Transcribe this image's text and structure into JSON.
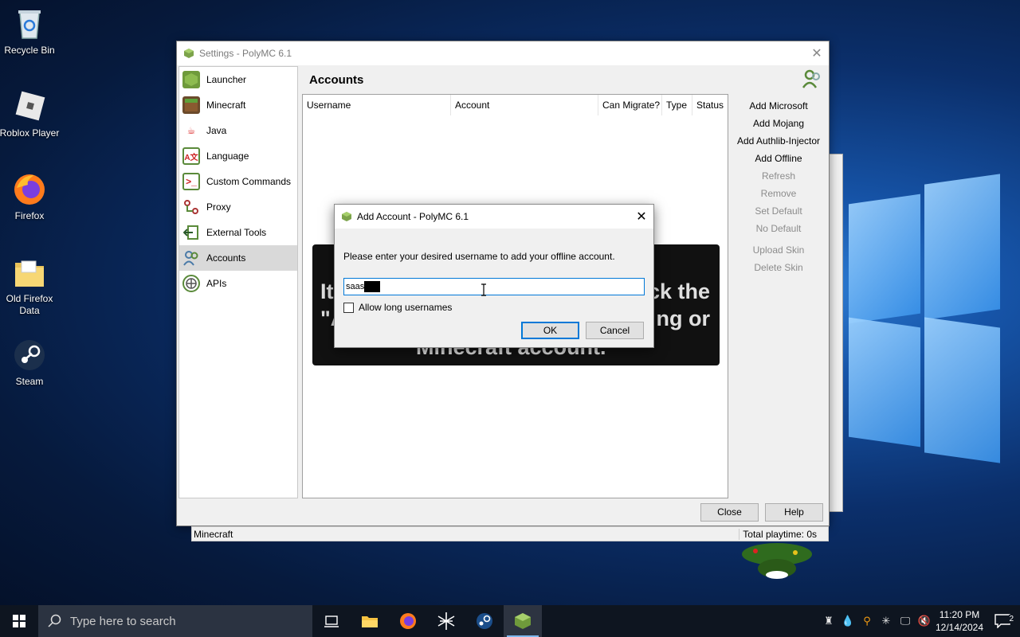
{
  "desktop": {
    "icons": [
      {
        "label": "Recycle Bin",
        "icon": "recycle-bin-icon"
      },
      {
        "label": "Roblox Player",
        "icon": "roblox-icon"
      },
      {
        "label": "Firefox",
        "icon": "firefox-icon"
      },
      {
        "label": "Old Firefox Data",
        "icon": "folder-icon"
      },
      {
        "label": "Steam",
        "icon": "steam-icon"
      }
    ]
  },
  "settings_window": {
    "title": "Settings - PolyMC 6.1",
    "sidebar": [
      {
        "label": "Launcher",
        "icon": "launcher-icon"
      },
      {
        "label": "Minecraft",
        "icon": "minecraft-icon"
      },
      {
        "label": "Java",
        "icon": "java-icon"
      },
      {
        "label": "Language",
        "icon": "language-icon"
      },
      {
        "label": "Custom Commands",
        "icon": "terminal-icon"
      },
      {
        "label": "Proxy",
        "icon": "proxy-icon"
      },
      {
        "label": "External Tools",
        "icon": "external-tools-icon"
      },
      {
        "label": "Accounts",
        "icon": "accounts-icon",
        "active": true
      },
      {
        "label": "APIs",
        "icon": "apis-icon"
      }
    ],
    "page_title": "Accounts",
    "table_headers": [
      "Username",
      "Account",
      "Can Migrate?",
      "Type",
      "Status"
    ],
    "actions": [
      {
        "label": "Add Microsoft",
        "enabled": true
      },
      {
        "label": "Add Mojang",
        "enabled": true
      },
      {
        "label": "Add Authlib-Injector",
        "enabled": true
      },
      {
        "label": "Add Offline",
        "enabled": true
      },
      {
        "label": "Refresh",
        "enabled": false
      },
      {
        "label": "Remove",
        "enabled": false
      },
      {
        "label": "Set Default",
        "enabled": false
      },
      {
        "label": "No Default",
        "enabled": false
      },
      {
        "label": "Upload Skin",
        "enabled": false
      },
      {
        "label": "Delete Skin",
        "enabled": false
      }
    ],
    "close_label": "Close",
    "help_label": "Help"
  },
  "statusbar": {
    "left": "Minecraft",
    "right": "Total playtime: 0s"
  },
  "banner": {
    "line1_left": "It",
    "line1_right": "ck the",
    "line2_left": "\"A",
    "line2_right": "ng or",
    "line3": "Minecraft account."
  },
  "dialog": {
    "title": "Add Account - PolyMC 6.1",
    "message": "Please enter your desired username to add your offline account.",
    "input_value": "saas",
    "checkbox_label": "Allow long usernames",
    "checkbox_checked": false,
    "ok_label": "OK",
    "cancel_label": "Cancel"
  },
  "taskbar": {
    "search_placeholder": "Type here to search",
    "apps": [
      "task-view-icon",
      "file-explorer-icon",
      "firefox-icon",
      "perplexity-icon",
      "steam-icon",
      "polymc-icon"
    ],
    "time": "11:20 PM",
    "date": "12/14/2024",
    "notification_count": "2"
  }
}
